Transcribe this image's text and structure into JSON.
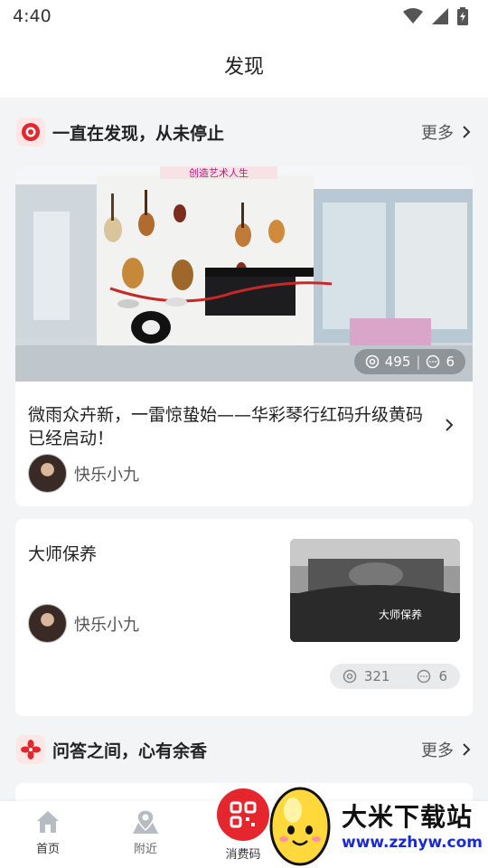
{
  "status_bar": {
    "time": "4:40"
  },
  "header": {
    "title": "发现"
  },
  "section1": {
    "title": "一直在发现，从未停止",
    "more": "更多"
  },
  "article1": {
    "title": "微雨众卉新，一雷惊蛰始——华彩琴行红码升级黄码已经启动！",
    "views": "495",
    "comments": "6",
    "author": "快乐小九",
    "photo_sign": "创造艺术人生"
  },
  "article2": {
    "title": "大师保养",
    "author": "快乐小九",
    "views": "321",
    "comments": "6",
    "thumb_text": "大师保养"
  },
  "section2": {
    "title": "问答之间，心有余香",
    "more": "更多"
  },
  "bottom_nav": {
    "items": [
      {
        "label": "首页",
        "icon": "home-icon"
      },
      {
        "label": "附近",
        "icon": "location-icon"
      },
      {
        "label": "消费码",
        "icon": "qr-code-icon"
      }
    ]
  },
  "watermark": {
    "title": "大米下载站",
    "url": "www.zzhyw.com"
  },
  "colors": {
    "accent_red": "#e5262c",
    "background": "#f3f4f6"
  }
}
